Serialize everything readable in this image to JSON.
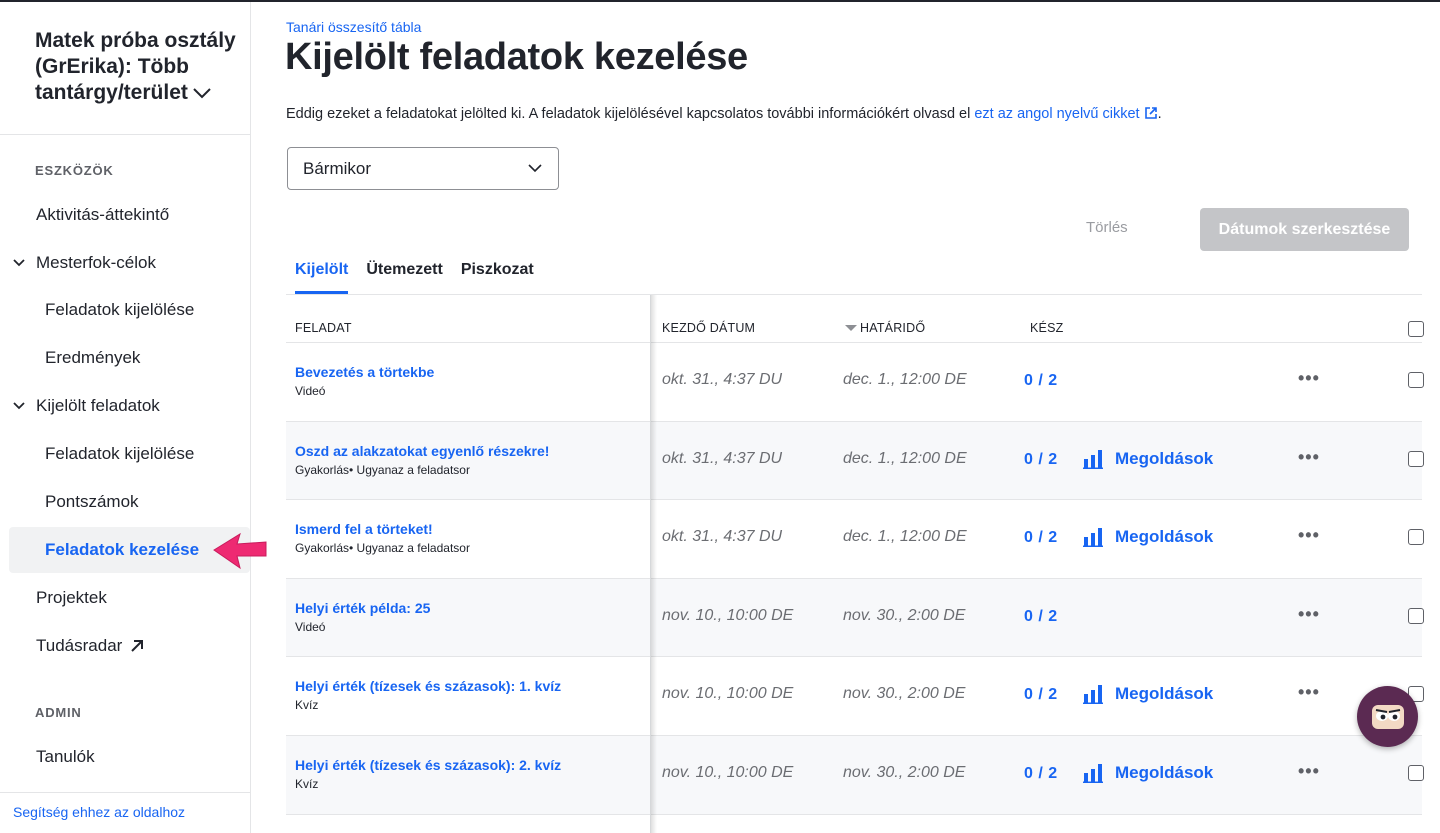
{
  "sidebar": {
    "class_title": "Matek próba osztály (GrErika): Több tantárgy/terület",
    "section_tools": "ESZKÖZÖK",
    "section_admin": "ADMIN",
    "items": [
      {
        "label": "Aktivitás-áttekintő"
      },
      {
        "label": "Mesterfok-célok"
      },
      {
        "label": "Feladatok kijelölése"
      },
      {
        "label": "Eredmények"
      },
      {
        "label": "Kijelölt feladatok"
      },
      {
        "label": "Feladatok kijelölése"
      },
      {
        "label": "Pontszámok"
      },
      {
        "label": "Feladatok kezelése"
      },
      {
        "label": "Projektek"
      },
      {
        "label": "Tudásradar"
      },
      {
        "label": "Tanulók"
      }
    ],
    "help_link": "Segítség ehhez az oldalhoz"
  },
  "main": {
    "breadcrumb": "Tanári összesítő tábla",
    "title": "Kijelölt feladatok kezelése",
    "intro_text": "Eddig ezeket a feladatokat jelölted ki. A feladatok kijelölésével kapcsolatos további információkért olvasd el",
    "intro_link": "ezt az angol nyelvű cikket",
    "intro_end": ".",
    "filter_value": "Bármikor",
    "delete_label": "Törlés",
    "edit_dates_label": "Dátumok szerkesztése",
    "tabs": [
      {
        "label": "Kijelölt"
      },
      {
        "label": "Ütemezett"
      },
      {
        "label": "Piszkozat"
      }
    ],
    "table": {
      "headers": {
        "task": "FELADAT",
        "start": "KEZDŐ DÁTUM",
        "due": "HATÁRIDŐ",
        "done": "KÉSZ"
      },
      "rows": [
        {
          "title": "Bevezetés a törtekbe",
          "subtitle": "Videó",
          "start": "okt. 31., 4:37 DU",
          "due": "dec. 1., 12:00 DE",
          "done": "0 / 2",
          "solutions": ""
        },
        {
          "title": "Oszd az alakzatokat egyenlő részekre!",
          "subtitle": "Gyakorlás• Ugyanaz a feladatsor",
          "start": "okt. 31., 4:37 DU",
          "due": "dec. 1., 12:00 DE",
          "done": "0 / 2",
          "solutions": "Megoldások"
        },
        {
          "title": "Ismerd fel a törteket!",
          "subtitle": "Gyakorlás• Ugyanaz a feladatsor",
          "start": "okt. 31., 4:37 DU",
          "due": "dec. 1., 12:00 DE",
          "done": "0 / 2",
          "solutions": "Megoldások"
        },
        {
          "title": "Helyi érték példa: 25",
          "subtitle": "Videó",
          "start": "nov. 10., 10:00 DE",
          "due": "nov. 30., 2:00 DE",
          "done": "0 / 2",
          "solutions": ""
        },
        {
          "title": "Helyi érték (tízesek és százasok): 1. kvíz",
          "subtitle": "Kvíz",
          "start": "nov. 10., 10:00 DE",
          "due": "nov. 30., 2:00 DE",
          "done": "0 / 2",
          "solutions": "Megoldások"
        },
        {
          "title": "Helyi érték (tízesek és százasok): 2. kvíz",
          "subtitle": "Kvíz",
          "start": "nov. 10., 10:00 DE",
          "due": "nov. 30., 2:00 DE",
          "done": "0 / 2",
          "solutions": "Megoldások"
        }
      ],
      "more_label": "•••"
    }
  },
  "colors": {
    "accent": "#1865f2",
    "pink_arrow": "#ee2a72",
    "avatar_bg": "#5b2a52"
  },
  "icons": [
    "chevron-down-icon",
    "external-link-icon",
    "arrow-up-right-icon",
    "bar-chart-icon",
    "more-icon",
    "caret-down-icon",
    "avatar-icon"
  ]
}
